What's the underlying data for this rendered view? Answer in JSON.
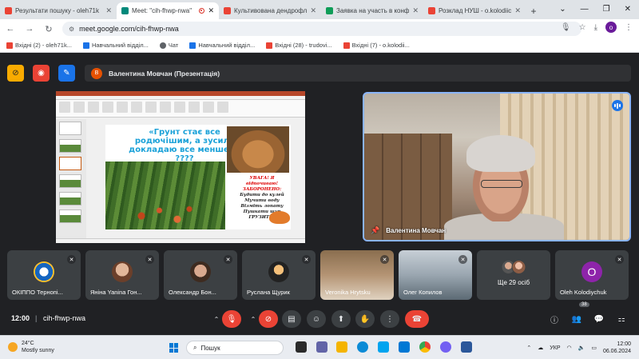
{
  "browser": {
    "tabs": [
      {
        "title": "Результати пошуку - oleh71k",
        "icon": "gmail-icon",
        "color": "#ea4335",
        "active": false
      },
      {
        "title": "Meet: \"cih-fhwp-nwa\"",
        "icon": "meet-icon",
        "color": "#00897b",
        "active": true
      },
      {
        "title": "Культивована дендрофлор",
        "icon": "gmail-icon",
        "color": "#ea4335",
        "active": false
      },
      {
        "title": "Заявка на участь в конфер",
        "icon": "sheets-icon",
        "color": "#0f9d58",
        "active": false
      },
      {
        "title": "Розклад НУШ - o.kolodiichu",
        "icon": "gmail-icon",
        "color": "#ea4335",
        "active": false
      }
    ],
    "url": "meet.google.com/cih-fhwp-nwa",
    "profile_initial": "o",
    "bookmarks": [
      {
        "label": "Вхідні (2) - oleh71k...",
        "icon": "gmail-icon",
        "color": "#ea4335"
      },
      {
        "label": "Навчальний відділ...",
        "icon": "doc-icon",
        "color": "#1a73e8"
      },
      {
        "label": "Чат",
        "icon": "chat-icon",
        "color": "#5f6368"
      },
      {
        "label": "Навчальний відділ...",
        "icon": "doc-icon",
        "color": "#1a73e8"
      },
      {
        "label": "Вхідні (28) - trudovi...",
        "icon": "gmail-icon",
        "color": "#ea4335"
      },
      {
        "label": "Вхідні (7) - o.kolodii...",
        "icon": "gmail-icon",
        "color": "#ea4335"
      }
    ]
  },
  "meet": {
    "presenter_initial": "В",
    "presenter_bar": "Валентина Мовчан (Презентація)",
    "slide": {
      "title": "«Грунт стає все родючішим, а зусиль докладаю все менше» - ????",
      "warn_line1": "УВАГА! Я відпочиваю!",
      "warn_line2": "ЗАБОРОНЕНО:",
      "warn_lines": [
        "Будити до кулей",
        "Мучити воду",
        "Візміть лопату",
        "Пушкати щур",
        "ГРУЗИТИ!"
      ]
    },
    "speaker_name": "Валентина Мовчан",
    "participants": [
      {
        "name": "ОКІППО Тернопі...",
        "avatar": "logo"
      },
      {
        "name": "Яніна Yanina Гон...",
        "avatar": "p1"
      },
      {
        "name": "Олександр Бон...",
        "avatar": "p2"
      },
      {
        "name": "Руслана Щурик",
        "avatar": "p3"
      },
      {
        "name": "Veronika Hrytsku",
        "avatar": "vid1"
      },
      {
        "name": "Олег Копилов",
        "avatar": "vid2"
      },
      {
        "name": "Ще 29 осіб",
        "avatar": "others"
      },
      {
        "name": "Oleh Kolodiychuk",
        "avatar": "o",
        "initial": "O"
      }
    ],
    "time": "12:00",
    "meeting_code": "cih-fhwp-nwa",
    "people_count": "38"
  },
  "taskbar": {
    "weather_temp": "24°C",
    "weather_desc": "Mostly sunny",
    "search_placeholder": "Пошук",
    "lang": "УКР",
    "time": "12:00",
    "date": "06.06.2024"
  }
}
